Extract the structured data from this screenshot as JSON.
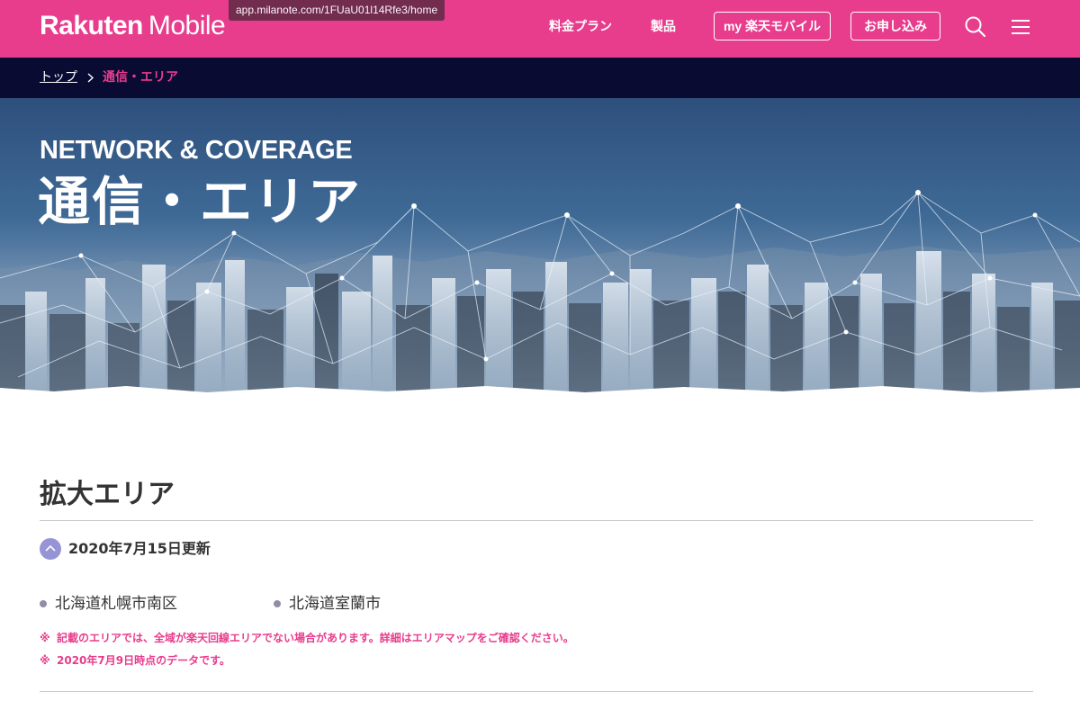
{
  "header": {
    "brand_bold": "Rakuten",
    "brand_light": "Mobile",
    "tooltip_pre": "milanote",
    "tooltip_url": "app.milanote.com/1FUaU01l14Rfe3/home",
    "nav": {
      "plans": "料金プラン",
      "products": "製品",
      "my_rakuten": "my 楽天モバイル",
      "apply": "お申し込み"
    },
    "icons": {
      "search": "search-icon",
      "menu": "hamburger-menu-icon"
    },
    "colors": {
      "brand": "#e83c8c",
      "navy": "#0a0b33"
    }
  },
  "breadcrumb": {
    "home": "トップ",
    "current": "通信・エリア"
  },
  "hero": {
    "title_en": "NETWORK & COVERAGE",
    "title_ja": "通信・エリア"
  },
  "section": {
    "title": "拡大エリア",
    "update_date": "2020年7月15日更新",
    "areas": [
      "北海道札幌市南区",
      "北海道室蘭市"
    ],
    "note_mark": "※",
    "notes": [
      "記載のエリアでは、全域が楽天回線エリアでない場合があります。詳細はエリアマップをご確認ください。",
      "2020年7月9日時点のデータです。"
    ]
  }
}
